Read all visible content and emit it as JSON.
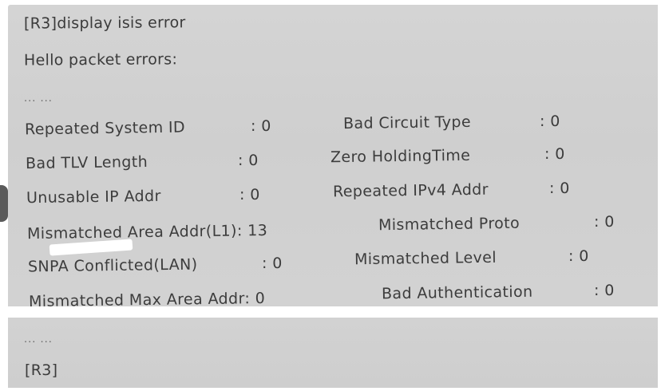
{
  "terminal": {
    "command": "[R3]display isis error",
    "section_title": "Hello packet errors:",
    "ellipsis_top": "... ...",
    "ellipsis_bottom": "... ...",
    "prompt": "[R3]"
  },
  "counters": [
    {
      "left_label": "Repeated System ID",
      "left_value": ": 0",
      "right_label": "Bad Circuit Type",
      "right_value": ": 0"
    },
    {
      "left_label": "Bad TLV Length",
      "left_value": ": 0",
      "right_label": "Zero HoldingTime",
      "right_value": ": 0"
    },
    {
      "left_label": "Unusable IP Addr",
      "left_value": ": 0",
      "right_label": "Repeated IPv4 Addr",
      "right_value": ": 0"
    },
    {
      "left_label": "Mismatched Area Addr(L1): 13",
      "left_value": "",
      "right_label": "Mismatched Proto",
      "right_value": ": 0"
    },
    {
      "left_label": "SNPA Conflicted(LAN)",
      "left_value": ": 0",
      "right_label": "Mismatched Level",
      "right_value": ": 0"
    },
    {
      "left_label": "Mismatched Max Area Addr: 0",
      "left_value": "",
      "right_label": "Bad Authentication",
      "right_value": ": 0"
    }
  ]
}
